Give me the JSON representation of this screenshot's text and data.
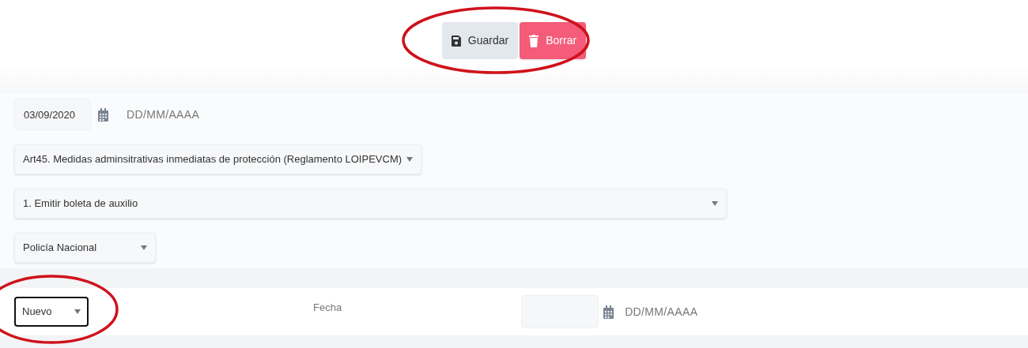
{
  "toolbar": {
    "buttons": [
      {
        "kind": "save",
        "label": "Guardar"
      },
      {
        "kind": "delete",
        "label": "Borrar"
      }
    ]
  },
  "form": {
    "date": {
      "value": "03/09/2020",
      "format_hint": "DD/MM/AAAA"
    },
    "selects": [
      {
        "value": "Art45. Medidas adminsitrativas inmediatas de protección (Reglamento LOIPEVCM)"
      },
      {
        "value": "1. Emitir boleta de auxilio"
      },
      {
        "value": "Policía Nacional"
      }
    ]
  },
  "detail_row": {
    "status_select": {
      "value": "Nuevo",
      "focused": true
    },
    "date_label": "Fecha",
    "date": {
      "format_hint": "DD/MM/AAAA"
    }
  }
}
